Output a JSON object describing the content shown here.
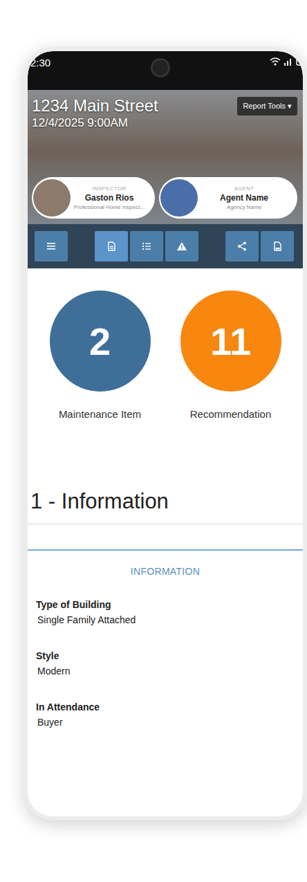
{
  "status_bar": {
    "time": "2:30"
  },
  "header": {
    "address": "1234 Main Street",
    "datetime": "12/4/2025 9:00AM",
    "report_tools": "Report Tools ▾",
    "inspector": {
      "role": "INSPECTOR",
      "name": "Gaston Rios",
      "subtitle": "Professional Home Inspect..."
    },
    "agent": {
      "role": "AGENT",
      "name": "Agent Name",
      "subtitle": "Agency Name"
    }
  },
  "toolbar": {
    "buttons": [
      {
        "kind": "menu",
        "selected": false
      },
      {
        "kind": "document",
        "selected": true
      },
      {
        "kind": "list",
        "selected": false
      },
      {
        "kind": "warning",
        "selected": false
      },
      {
        "kind": "share",
        "selected": false
      },
      {
        "kind": "pdf",
        "selected": false
      }
    ]
  },
  "summary": [
    {
      "count": "2",
      "label": "Maintenance Item",
      "color": "#3f6e98"
    },
    {
      "count": "11",
      "label": "Recommendation",
      "color": "#f7870f"
    }
  ],
  "section": {
    "title": "1 - Information",
    "card_title": "INFORMATION",
    "fields": [
      {
        "label": "Type of Building",
        "value": "Single Family Attached"
      },
      {
        "label": "Style",
        "value": "Modern"
      },
      {
        "label": "In Attendance",
        "value": "Buyer"
      }
    ]
  }
}
